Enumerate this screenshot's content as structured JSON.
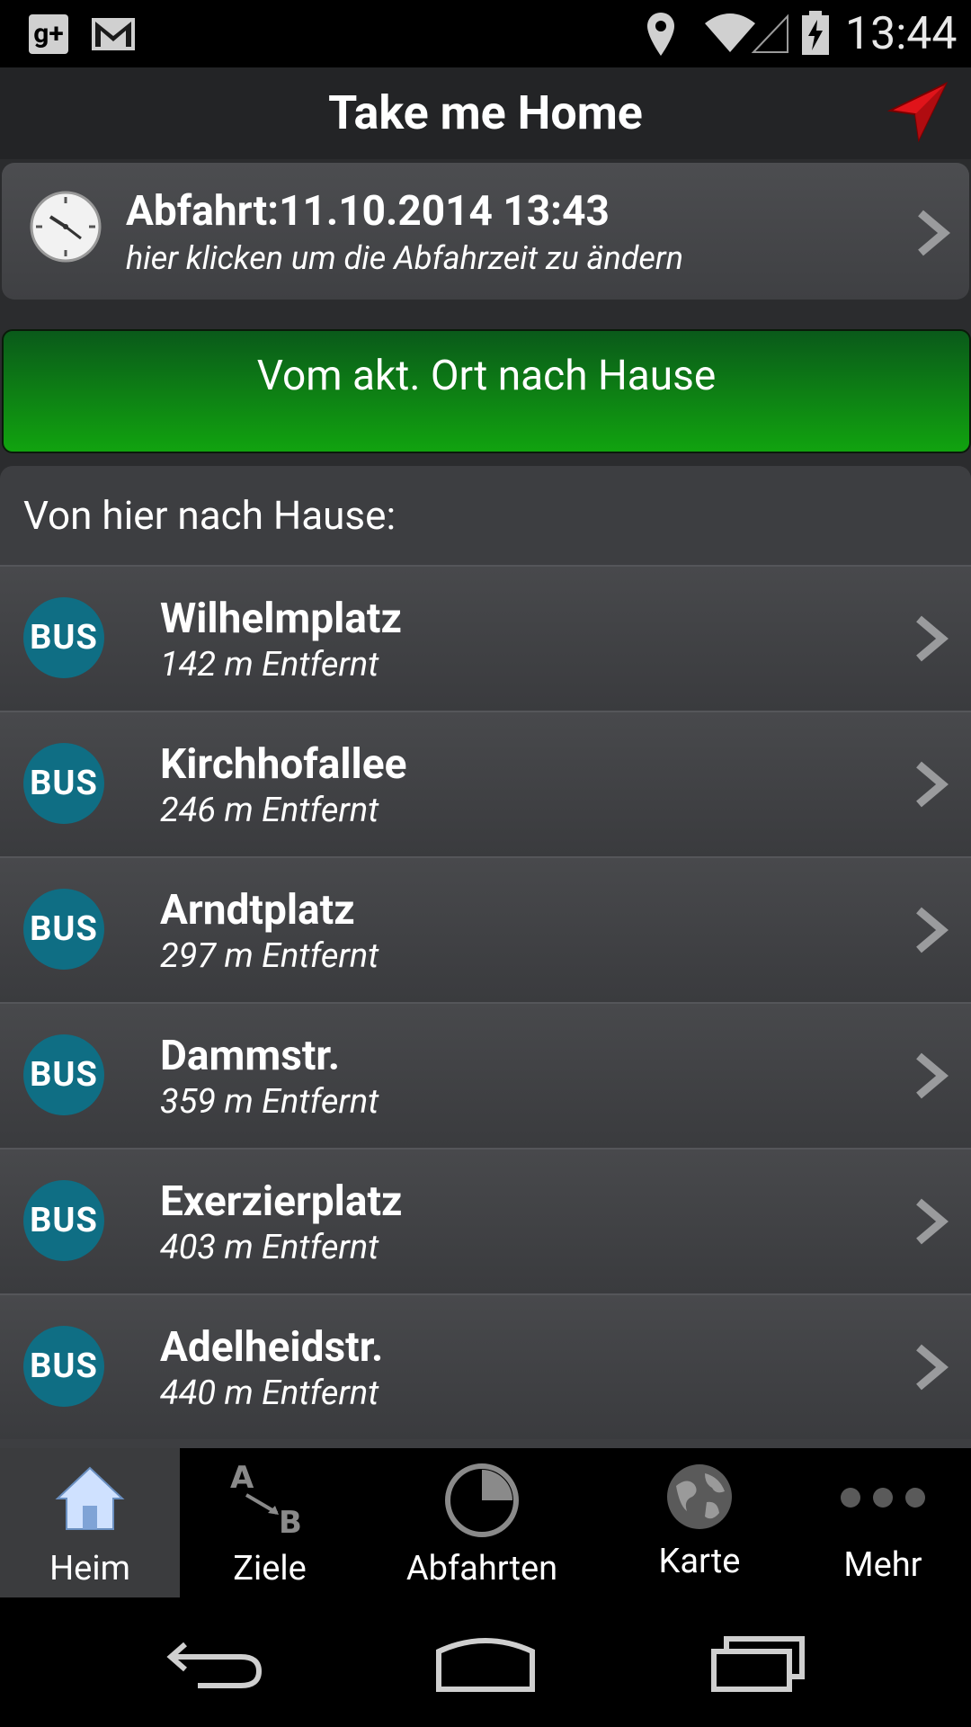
{
  "status_bar": {
    "time": "13:44",
    "notification_icons": [
      "google-plus-icon",
      "gmail-icon"
    ],
    "system_icons": [
      "location-icon",
      "wifi-icon",
      "signal-icon",
      "battery-charging-icon"
    ]
  },
  "action_bar": {
    "title": "Take me Home",
    "action_icon": "navigation-arrow-icon"
  },
  "departure": {
    "label": "Abfahrt:11.10.2014 13:43",
    "hint": "hier klicken um die Abfahrzeit zu ändern"
  },
  "home_button": {
    "label": "Vom akt. Ort nach Hause"
  },
  "stops": {
    "header": "Von hier nach Hause:",
    "items": [
      {
        "badge": "BUS",
        "name": "Wilhelmplatz",
        "distance": "142 m Entfernt"
      },
      {
        "badge": "BUS",
        "name": "Kirchhofallee",
        "distance": "246 m Entfernt"
      },
      {
        "badge": "BUS",
        "name": "Arndtplatz",
        "distance": "297 m Entfernt"
      },
      {
        "badge": "BUS",
        "name": "Dammstr.",
        "distance": "359 m Entfernt"
      },
      {
        "badge": "BUS",
        "name": "Exerzierplatz",
        "distance": "403 m Entfernt"
      },
      {
        "badge": "BUS",
        "name": "Adelheidstr.",
        "distance": "440 m Entfernt"
      }
    ]
  },
  "tabs": [
    {
      "label": "Heim",
      "icon": "house-icon",
      "active": true
    },
    {
      "label": "Ziele",
      "icon": "a-to-b-icon",
      "active": false
    },
    {
      "label": "Abfahrten",
      "icon": "pie-clock-icon",
      "active": false
    },
    {
      "label": "Karte",
      "icon": "globe-icon",
      "active": false
    },
    {
      "label": "Mehr",
      "icon": "more-dots-icon",
      "active": false
    }
  ],
  "nav_buttons": [
    "back-icon",
    "home-icon",
    "recents-icon"
  ],
  "colors": {
    "accent_green": "#11a30f",
    "bus_badge": "#0f6e84",
    "nav_arrow": "#e0141a"
  }
}
